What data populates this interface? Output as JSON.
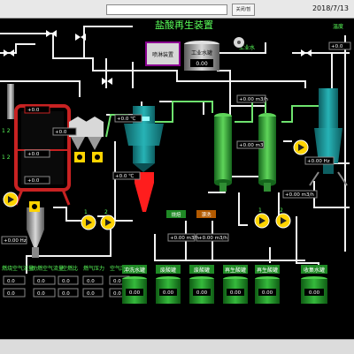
{
  "topbar": {
    "button_label": "关闭/暂",
    "date": "2018/7/13"
  },
  "title": "盐酸再生装置",
  "labels": {
    "industrial_water": "工业水罐",
    "industrial_water_line": "工业水",
    "seal_device": "喷淋装置",
    "temperature": "温度",
    "fan_sym": "风机",
    "steam": "蒸汽",
    "tag_12": "1 2",
    "combustion": "烧焙",
    "rinse": "漂洗",
    "hz": "Hz"
  },
  "values": {
    "tank_level": "0.00",
    "zero": "+0.0",
    "zero_c": "+0.0 ℃",
    "zero_mpa": "+0.0 MPa",
    "zero_m3h": "+0.00 m3/h",
    "zero_m3": "+0.00 m3",
    "zero_hz": "+0.00 Hz",
    "kpa": "+0.0 kPa",
    "pct": "0.0 %"
  },
  "pumps": [
    "1",
    "2",
    "1",
    "2",
    "1",
    "2",
    "1",
    "2"
  ],
  "table": {
    "headers": [
      "燃烧空气流量",
      "助燃空气流量",
      "空燃比",
      "燃气压力",
      "空气压力"
    ],
    "row1": [
      "0.0",
      "0.0",
      "0.0",
      "0.0",
      "0.0"
    ],
    "row2": [
      "0.0",
      "0.0",
      "0.0",
      "0.0",
      "0.0"
    ]
  },
  "tanks": {
    "labels": [
      "冲洗水罐",
      "废酸罐",
      "废酸罐",
      "再生酸罐",
      "再生酸罐",
      "收集水罐"
    ],
    "values": [
      "0.00",
      "0.00",
      "0.00",
      "0.00",
      "0.00",
      "0.00"
    ]
  },
  "colors": {
    "pipe_white": "#f2f2f2",
    "pipe_green": "#6fe36f",
    "vessel_teal": "#1f8f93",
    "column_green": "#37b34a",
    "reactor_red": "#c82222",
    "hopper_red": "#ff1d1d",
    "pump_yellow": "#ffd400",
    "tank_green": "#1f8a25",
    "value_bg": "#000000",
    "value_fg": "#ffffff"
  }
}
